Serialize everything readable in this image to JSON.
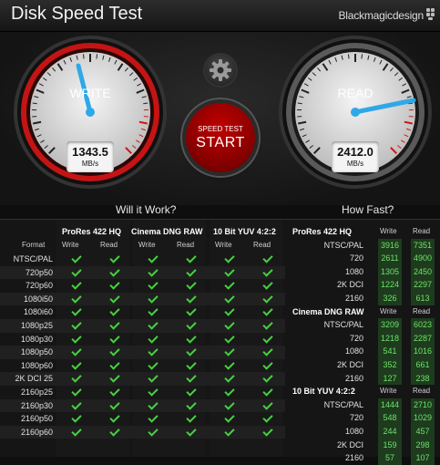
{
  "app": {
    "title": "Disk Speed Test",
    "brand": "Blackmagicdesign"
  },
  "write_gauge": {
    "label": "WRITE",
    "value": "1343.5",
    "unit": "MB/s"
  },
  "read_gauge": {
    "label": "READ",
    "value": "2412.0",
    "unit": "MB/s"
  },
  "start_button": {
    "small": "SPEED TEST",
    "big": "START"
  },
  "sections": {
    "left": "Will it Work?",
    "right": "How Fast?"
  },
  "will_it_work": {
    "format_header": "Format",
    "groups": [
      "ProRes 422 HQ",
      "Cinema DNG RAW",
      "10 Bit YUV 4:2:2"
    ],
    "sub": {
      "write": "Write",
      "read": "Read"
    },
    "rows": [
      "NTSC/PAL",
      "720p50",
      "720p60",
      "1080i50",
      "1080i60",
      "1080p25",
      "1080p30",
      "1080p50",
      "1080p60",
      "2K DCI 25",
      "2160p25",
      "2160p30",
      "2160p50",
      "2160p60"
    ]
  },
  "how_fast": {
    "sub": {
      "write": "Write",
      "read": "Read"
    },
    "groups": [
      {
        "title": "ProRes 422 HQ",
        "rows": [
          {
            "label": "NTSC/PAL",
            "write": "3916",
            "read": "7351"
          },
          {
            "label": "720",
            "write": "2611",
            "read": "4900"
          },
          {
            "label": "1080",
            "write": "1305",
            "read": "2450"
          },
          {
            "label": "2K DCI",
            "write": "1224",
            "read": "2297"
          },
          {
            "label": "2160",
            "write": "326",
            "read": "613"
          }
        ]
      },
      {
        "title": "Cinema DNG RAW",
        "rows": [
          {
            "label": "NTSC/PAL",
            "write": "3209",
            "read": "6023"
          },
          {
            "label": "720",
            "write": "1218",
            "read": "2287"
          },
          {
            "label": "1080",
            "write": "541",
            "read": "1016"
          },
          {
            "label": "2K DCI",
            "write": "352",
            "read": "661"
          },
          {
            "label": "2160",
            "write": "127",
            "read": "238"
          }
        ]
      },
      {
        "title": "10 Bit YUV 4:2:2",
        "rows": [
          {
            "label": "NTSC/PAL",
            "write": "1444",
            "read": "2710"
          },
          {
            "label": "720",
            "write": "548",
            "read": "1029"
          },
          {
            "label": "1080",
            "write": "244",
            "read": "457"
          },
          {
            "label": "2K DCI",
            "write": "159",
            "read": "298"
          },
          {
            "label": "2160",
            "write": "57",
            "read": "107"
          }
        ]
      }
    ]
  },
  "colors": {
    "write_accent": "#d01818",
    "needle": "#2fa8e8",
    "check": "#44d23e",
    "value_text": "#6fe06a"
  },
  "icons": {
    "settings": "gear-icon",
    "check": "check-icon"
  }
}
